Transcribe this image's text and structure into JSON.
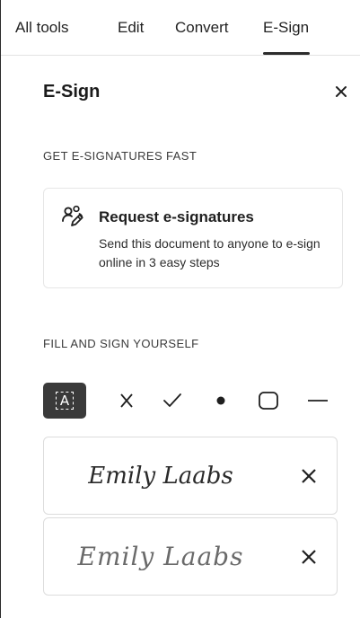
{
  "tabs": [
    {
      "label": "All tools"
    },
    {
      "label": "Edit"
    },
    {
      "label": "Convert"
    },
    {
      "label": "E-Sign"
    }
  ],
  "active_tab": "E-Sign",
  "panel": {
    "title": "E-Sign",
    "close_icon": "close-icon"
  },
  "get_signatures": {
    "section_label": "GET E-SIGNATURES FAST",
    "card": {
      "icon": "request-signatures-icon",
      "title": "Request e-signatures",
      "description": "Send this document to anyone to e-sign online in 3 easy steps"
    }
  },
  "fill_sign": {
    "section_label": "FILL AND SIGN YOURSELF",
    "tools": [
      {
        "name": "add-text",
        "glyph": "A"
      },
      {
        "name": "cross-mark",
        "glyph": "×"
      },
      {
        "name": "check-mark",
        "glyph": "✓"
      },
      {
        "name": "dot",
        "glyph": "●"
      },
      {
        "name": "rounded-box",
        "glyph": "▢"
      },
      {
        "name": "line",
        "glyph": "—"
      }
    ],
    "signatures": [
      {
        "text": "Emily Laabs",
        "style": "typed script"
      },
      {
        "text": "Emily Laabs",
        "style": "handwritten"
      }
    ]
  },
  "colors": {
    "accent_dark": "#3a3a3a",
    "border": "#dcdcdc",
    "frame_edge": "#2b2b2b"
  }
}
